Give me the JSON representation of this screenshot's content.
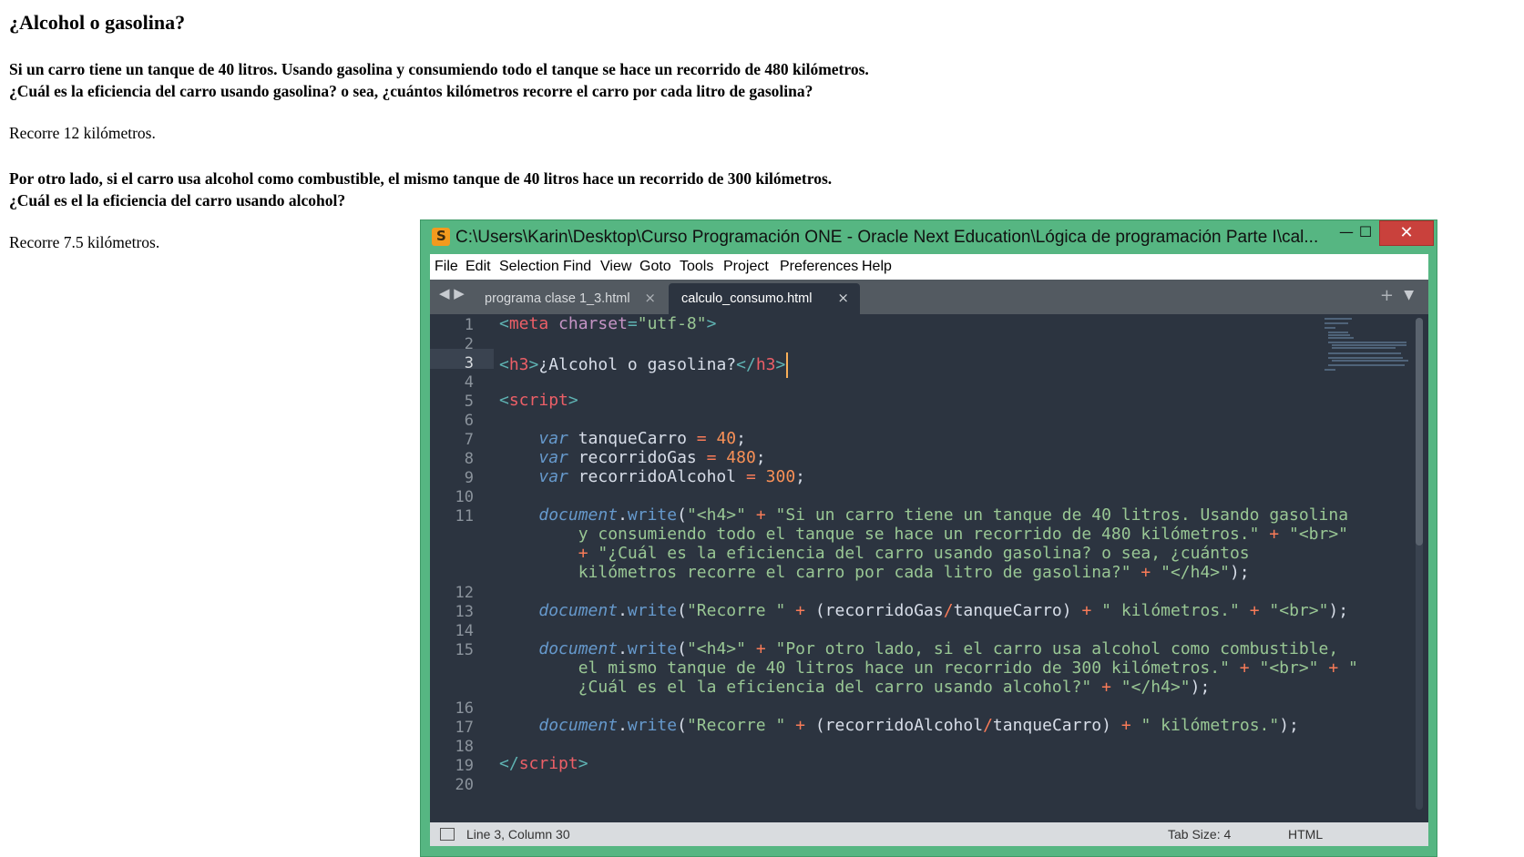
{
  "page": {
    "title": "¿Alcohol o gasolina?",
    "q1_line1": "Si un carro tiene un tanque de 40 litros. Usando gasolina y consumiendo todo el tanque se hace un recorrido de 480 kilómetros.",
    "q1_line2": "¿Cuál es la eficiencia del carro usando gasolina? o sea, ¿cuántos kilómetros recorre el carro por cada litro de gasolina?",
    "a1": "Recorre 12 kilómetros.",
    "q2_line1": "Por otro lado, si el carro usa alcohol como combustible, el mismo tanque de 40 litros hace un recorrido de 300 kilómetros.",
    "q2_line2": "¿Cuál es el la eficiencia del carro usando alcohol?",
    "a2": "Recorre 7.5 kilómetros."
  },
  "window": {
    "title": "C:\\Users\\Karin\\Desktop\\Curso Programación ONE - Oracle Next Education\\Lógica de programación Parte I\\cal...",
    "min_symbol": "—",
    "max_symbol": "☐",
    "close_symbol": "✕",
    "app_icon": "sublime-text-icon",
    "app_icon_glyph": "S"
  },
  "menu": {
    "items": [
      "File",
      "Edit",
      "Selection",
      "Find",
      "View",
      "Goto",
      "Tools",
      "Project",
      "Preferences",
      "Help"
    ]
  },
  "tabs": {
    "nav_arrows": "◀ ▶",
    "items": [
      {
        "label": "programa clase 1_3.html",
        "close": "×",
        "active": false
      },
      {
        "label": "calculo_consumo.html",
        "close": "×",
        "active": true
      }
    ],
    "plus": "+",
    "menu": "▼"
  },
  "editor": {
    "current_line": 3,
    "line_numbers": [
      "1",
      "2",
      "3",
      "4",
      "5",
      "6",
      "7",
      "8",
      "9",
      "10",
      "11",
      "12",
      "13",
      "14",
      "15",
      "16",
      "17",
      "18",
      "19",
      "20"
    ]
  },
  "status": {
    "position": "Line 3, Column 30",
    "tab_size": "Tab Size: 4",
    "syntax": "HTML"
  },
  "colors": {
    "window_frame": "#56b682",
    "editor_bg": "#2c3440",
    "tag": "#ec5f67",
    "string": "#99c794",
    "keyword": "#6699cc",
    "number": "#f99157",
    "close_button": "#c9413c"
  }
}
